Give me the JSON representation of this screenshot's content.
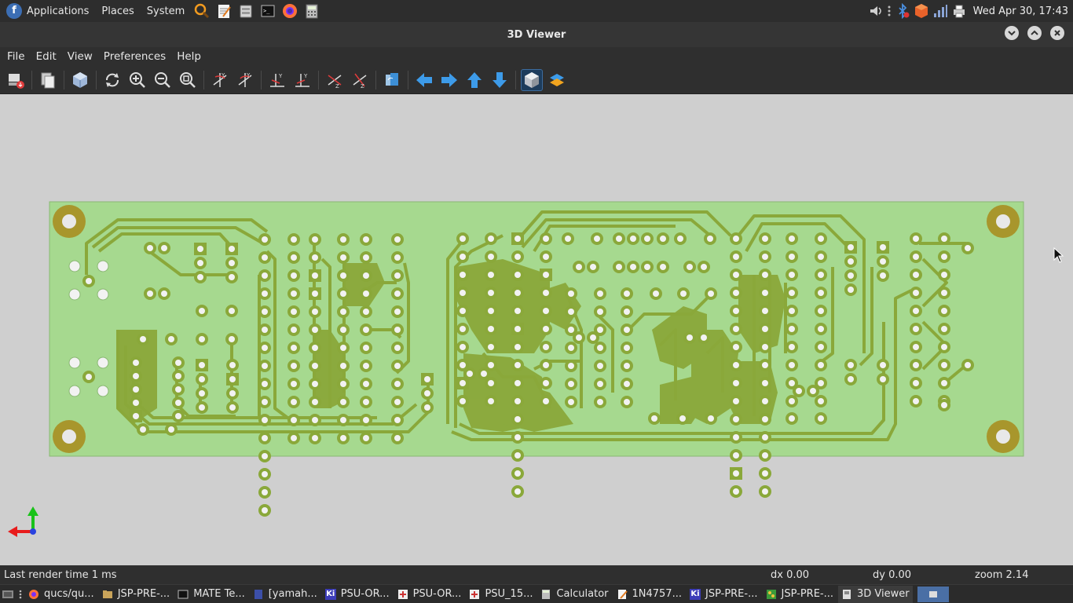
{
  "top_panel": {
    "menus": [
      "Applications",
      "Places",
      "System"
    ],
    "launchers": [
      "search-icon",
      "text-editor-icon",
      "file-manager-icon",
      "terminal-icon",
      "firefox-icon",
      "calculator-icon"
    ],
    "clock": "Wed Apr 30, 17:43"
  },
  "window": {
    "title": "3D Viewer"
  },
  "menubar": [
    "File",
    "Edit",
    "View",
    "Preferences",
    "Help"
  ],
  "status": {
    "message": "Last render time 1 ms",
    "dx": "dx 0.00",
    "dy": "dy 0.00",
    "zoom": "zoom 2.14"
  },
  "taskbar": [
    {
      "label": "qucs/qu...",
      "icon": "firefox-icon"
    },
    {
      "label": "JSP-PRE-...",
      "icon": "folder-icon"
    },
    {
      "label": "MATE Te...",
      "icon": "terminal-icon"
    },
    {
      "label": "[yamah...",
      "icon": "document-icon"
    },
    {
      "label": "PSU-OR...",
      "icon": "kicad-icon"
    },
    {
      "label": "PSU-OR...",
      "icon": "schematic-icon"
    },
    {
      "label": "PSU_15...",
      "icon": "schematic-icon"
    },
    {
      "label": "Calculator",
      "icon": "calculator-icon"
    },
    {
      "label": "1N4757...",
      "icon": "text-editor-icon"
    },
    {
      "label": "JSP-PRE-...",
      "icon": "kicad-icon"
    },
    {
      "label": "JSP-PRE-...",
      "icon": "pcb-icon"
    },
    {
      "label": "3D Viewer",
      "icon": "3d-viewer-icon"
    }
  ],
  "colors": {
    "board": "#a6d98f",
    "copper": "#8aa83a",
    "mounting_hole": "#a8962c",
    "canvas": "#cfcfcf"
  }
}
